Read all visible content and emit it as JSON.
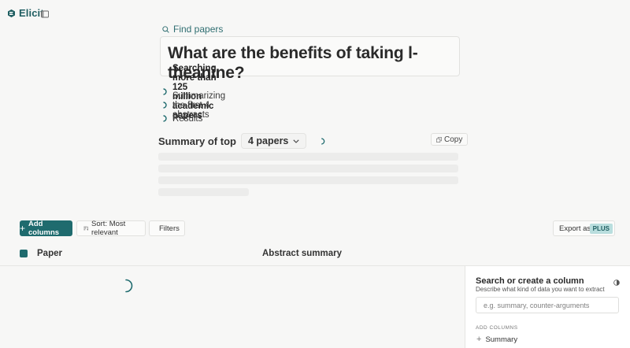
{
  "header": {
    "brand": "Elicit",
    "logo_icon": "elicit-logo-icon",
    "sidebar_toggle_icon": "sidebar-toggle-icon"
  },
  "search": {
    "find_label": "Find papers",
    "query": "What are the benefits of taking l-theanine?"
  },
  "steps": [
    {
      "label": "Searching more than 125 million academic papers"
    },
    {
      "label": "Summarizing the first 4 abstracts"
    },
    {
      "label": "Results"
    }
  ],
  "summary": {
    "label": "Summary of top",
    "selected": "4 papers",
    "copy_label": "Copy"
  },
  "toolbar": {
    "add_columns": "Add columns",
    "sort": "Sort: Most relevant",
    "filters": "Filters",
    "export": "Export as",
    "plus_badge": "PLUS"
  },
  "table": {
    "columns": [
      "Paper",
      "Abstract summary"
    ]
  },
  "panel": {
    "title": "Search or create a column",
    "description": "Describe what kind of data you want to extract",
    "input_placeholder": "e.g. summary, counter-arguments",
    "section_label": "ADD COLUMNS",
    "items": [
      "Summary"
    ]
  },
  "colors": {
    "accent": "#1f6b6e",
    "brand_text": "#1f5e61",
    "background": "#f7f7f6",
    "badge_bg": "#b9dede"
  }
}
